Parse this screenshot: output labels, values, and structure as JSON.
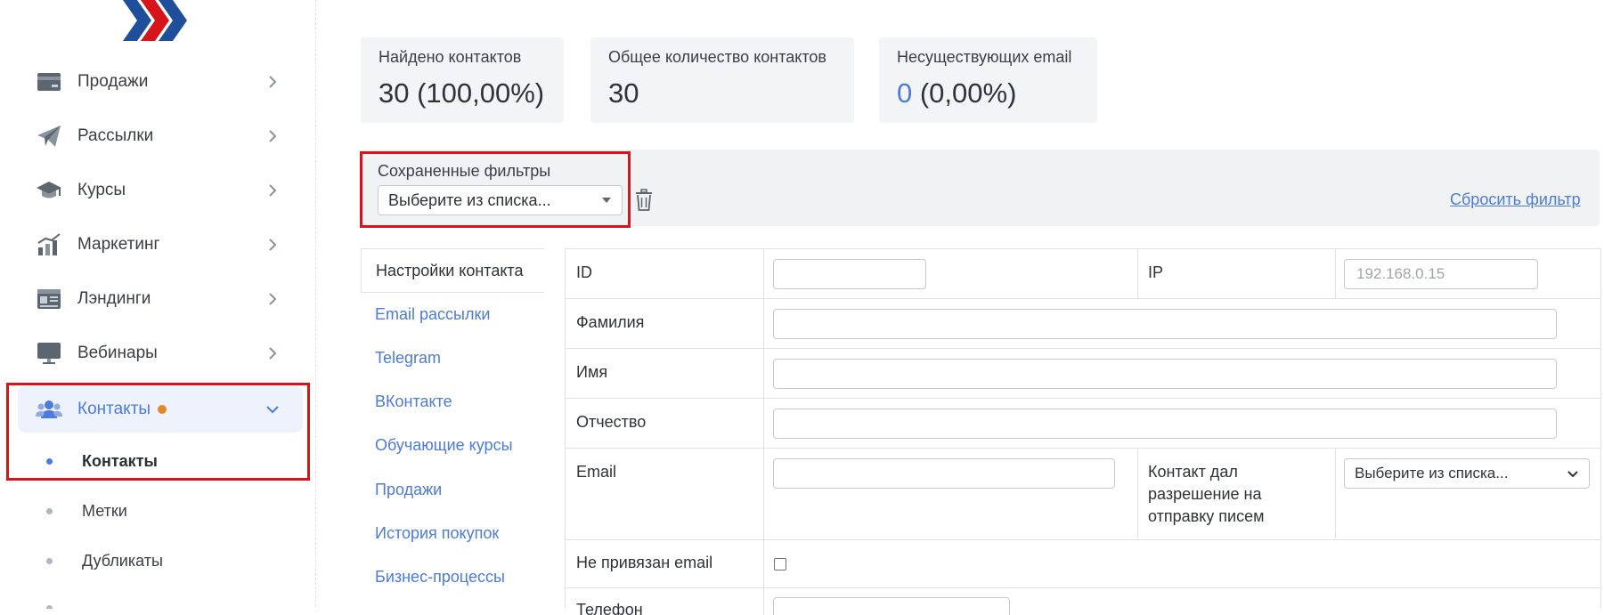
{
  "sidebar": {
    "items": [
      {
        "label": "Продажи",
        "icon": "credit-card-icon"
      },
      {
        "label": "Рассылки",
        "icon": "paper-plane-icon"
      },
      {
        "label": "Курсы",
        "icon": "graduation-cap-icon"
      },
      {
        "label": "Маркетинг",
        "icon": "chart-growth-icon"
      },
      {
        "label": "Лэндинги",
        "icon": "landing-page-icon"
      },
      {
        "label": "Вебинары",
        "icon": "monitor-icon"
      },
      {
        "label": "Контакты",
        "icon": "users-icon"
      }
    ],
    "sub_items": [
      {
        "label": "Контакты"
      },
      {
        "label": "Метки"
      },
      {
        "label": "Дубликаты"
      }
    ],
    "badge_color": "#e0892a",
    "accent_color": "#4d7bd9"
  },
  "stats": [
    {
      "title": "Найдено контактов",
      "value": "30 (100,00%)"
    },
    {
      "title": "Общее количество контактов",
      "value": "30"
    },
    {
      "title": "Несуществующих email",
      "value_highlight": "0",
      "value_rest": " (0,00%)"
    }
  ],
  "filter": {
    "label": "Сохраненные фильтры",
    "select_value": "Выберите из списка...",
    "reset_label": "Сбросить фильтр"
  },
  "tabs": [
    {
      "label": "Настройки контакта"
    },
    {
      "label": "Email рассылки"
    },
    {
      "label": "Telegram"
    },
    {
      "label": "ВКонтакте"
    },
    {
      "label": "Обучающие курсы"
    },
    {
      "label": "Продажи"
    },
    {
      "label": "История покупок"
    },
    {
      "label": "Бизнес-процессы"
    }
  ],
  "form": {
    "id_label": "ID",
    "ip_label": "IP",
    "ip_placeholder": "192.168.0.15",
    "lastname_label": "Фамилия",
    "firstname_label": "Имя",
    "patronymic_label": "Отчество",
    "email_label": "Email",
    "consent_label_1": "Контакт дал",
    "consent_label_2": "разрешение на",
    "consent_label_3": "отправку писем",
    "consent_select": "Выберите из списка...",
    "no_email_label": "Не привязан email",
    "phone_label": "Телефон"
  }
}
